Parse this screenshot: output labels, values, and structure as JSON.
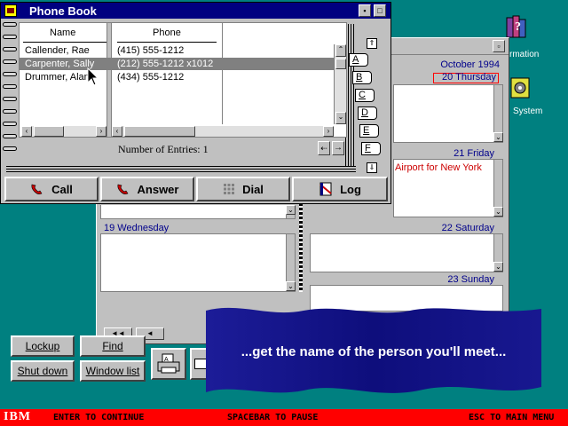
{
  "desktop": {
    "icons": [
      {
        "label": "rmation",
        "icon": "information-icon"
      },
      {
        "label": "System",
        "icon": "system-icon"
      }
    ]
  },
  "calendar": {
    "month": "October 1994",
    "days": [
      {
        "label": "20 Thursday",
        "event": ""
      },
      {
        "label": "21 Friday",
        "event": "Airport for New York"
      },
      {
        "label": "22 Saturday",
        "event": ""
      },
      {
        "label": "23 Sunday",
        "event": ""
      },
      {
        "label": "19 Wednesday",
        "event": ""
      }
    ],
    "nav": {
      "first": "◄◄",
      "prev": "◄"
    }
  },
  "phonebook": {
    "title": "Phone Book",
    "columns": {
      "name": "Name",
      "phone": "Phone"
    },
    "entries": [
      {
        "name": "Callender, Rae",
        "phone": "(415) 555-1212"
      },
      {
        "name": "Carpenter, Sally",
        "phone": "(212) 555-1212 x1012",
        "selected": true
      },
      {
        "name": "Drummer, Alan",
        "phone": "(434) 555-1212"
      }
    ],
    "count_text": "Number of Entries: 1",
    "tabs": [
      "A",
      "B",
      "C",
      "D",
      "E",
      "F"
    ],
    "actions": {
      "call": "Call",
      "answer": "Answer",
      "dial": "Dial",
      "log": "Log"
    }
  },
  "launcher": {
    "lockup": "Lockup",
    "find": "Find",
    "shutdown": "Shut down",
    "windowlist": "Window list"
  },
  "banner": {
    "text": "...get the name of the person you'll meet..."
  },
  "statusbar": {
    "brand": "IBM",
    "continue": "ENTER TO CONTINUE",
    "pause": "SPACEBAR TO PAUSE",
    "esc": "ESC TO MAIN MENU"
  },
  "colors": {
    "desktop": "#008080",
    "titlebar": "#000080",
    "status": "#ff0000",
    "banner": "#10108a",
    "selection": "#808080",
    "calendar_head": "#00008b",
    "event_text": "#cc0000"
  }
}
